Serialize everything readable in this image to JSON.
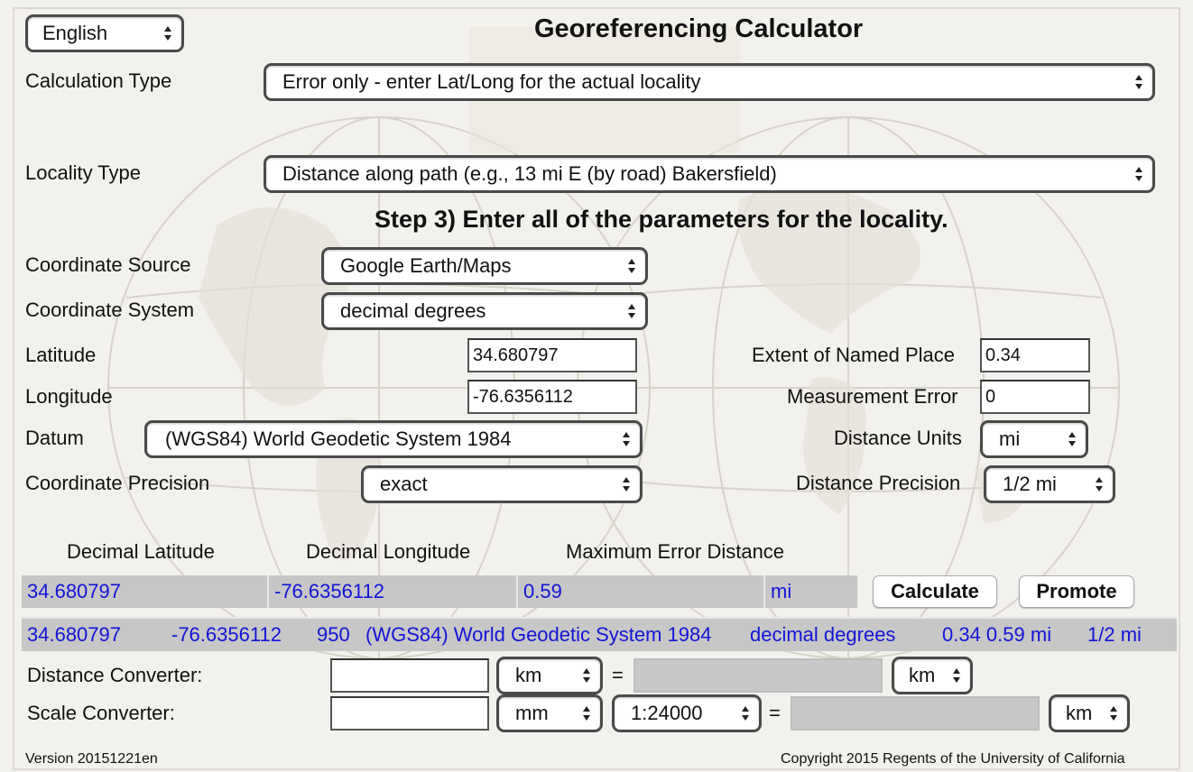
{
  "language": {
    "selected": "English"
  },
  "title": "Georeferencing Calculator",
  "calculation_type": {
    "label": "Calculation Type",
    "selected": "Error only - enter Lat/Long for the actual locality"
  },
  "locality_type": {
    "label": "Locality Type",
    "selected": "Distance along path (e.g., 13 mi E (by road) Bakersfield)"
  },
  "step_heading": "Step 3) Enter all of the parameters for the locality.",
  "coordinate_source": {
    "label": "Coordinate Source",
    "selected": "Google Earth/Maps"
  },
  "coordinate_system": {
    "label": "Coordinate System",
    "selected": "decimal degrees"
  },
  "latitude": {
    "label": "Latitude",
    "value": "34.680797"
  },
  "longitude": {
    "label": "Longitude",
    "value": "-76.6356112"
  },
  "datum": {
    "label": "Datum",
    "selected": "(WGS84) World Geodetic System 1984"
  },
  "coordinate_precision": {
    "label": "Coordinate Precision",
    "selected": "exact"
  },
  "extent": {
    "label": "Extent of Named Place",
    "value": "0.34"
  },
  "measurement_error": {
    "label": "Measurement Error",
    "value": "0"
  },
  "distance_units": {
    "label": "Distance Units",
    "selected": "mi"
  },
  "distance_precision": {
    "label": "Distance Precision",
    "selected": "1/2 mi"
  },
  "results": {
    "headers": {
      "lat": "Decimal Latitude",
      "lng": "Decimal Longitude",
      "err": "Maximum Error Distance"
    },
    "lat": "34.680797",
    "lng": "-76.6356112",
    "err": "0.59",
    "units": "mi",
    "calculate_label": "Calculate",
    "promote_label": "Promote"
  },
  "summary": {
    "lat": "34.680797",
    "lng": "-76.6356112",
    "num": "950",
    "datum": "(WGS84) World Geodetic System 1984",
    "system": "decimal degrees",
    "err": "0.34 0.59 mi",
    "precision": "1/2 mi"
  },
  "distance_converter": {
    "label": "Distance Converter:",
    "input_value": "",
    "from_unit": "km",
    "equals": "=",
    "to_unit": "km"
  },
  "scale_converter": {
    "label": "Scale Converter:",
    "input_value": "",
    "from_unit": "mm",
    "scale": "1:24000",
    "equals": "=",
    "to_unit": "km"
  },
  "footer": {
    "version": "Version 20151221en",
    "copyright": "Copyright 2015 Regents of the University of California"
  },
  "colors": {
    "result_text": "#1414d8",
    "result_bg": "#c7c7c7",
    "page_bg": "#f3f2ef"
  },
  "icons": {
    "select_arrow": "up-down-chevron-icon"
  }
}
